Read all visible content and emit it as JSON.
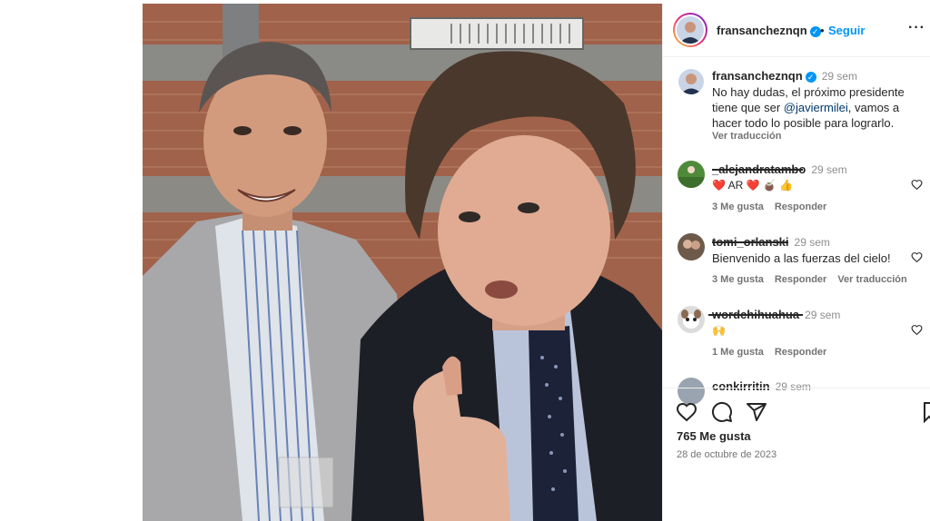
{
  "post": {
    "username": "fransancheznqn",
    "follow_label": "Seguir",
    "caption_username": "fransancheznqn",
    "caption_time": "29 sem",
    "caption_before": "No hay dudas, el próximo presidente tiene que ser ",
    "caption_mention": "@javiermilei",
    "caption_after": ", vamos a hacer todo lo posible para lograrlo.",
    "translate_label": "Ver traducción",
    "likes": "765 Me gusta",
    "date": "28 de octubre de 2023"
  },
  "comments": [
    {
      "username": "_alejandratambo",
      "time": "29 sem",
      "text": "❤️ AR ❤️ 🧉 👍",
      "likes": "3 Me gusta",
      "reply": "Responder",
      "translate": ""
    },
    {
      "username": "tomi_orlanski",
      "time": "29 sem",
      "text": "Bienvenido a las fuerzas del cielo!",
      "likes": "3 Me gusta",
      "reply": "Responder",
      "translate": "Ver traducción"
    },
    {
      "username": "wordchihuahua",
      "time": "29 sem",
      "text": "🙌",
      "likes": "1 Me gusta",
      "reply": "Responder",
      "translate": ""
    },
    {
      "username": "conkirritin",
      "time": "29 sem",
      "text": "",
      "likes": "",
      "reply": "",
      "translate": ""
    }
  ],
  "icons": {
    "like": "heart-icon",
    "comment": "comment-icon",
    "share": "share-icon",
    "more": "more-icon",
    "verified": "verified-badge-icon"
  },
  "colors": {
    "accent": "#0095f6",
    "text": "#262626",
    "muted": "#737373"
  }
}
